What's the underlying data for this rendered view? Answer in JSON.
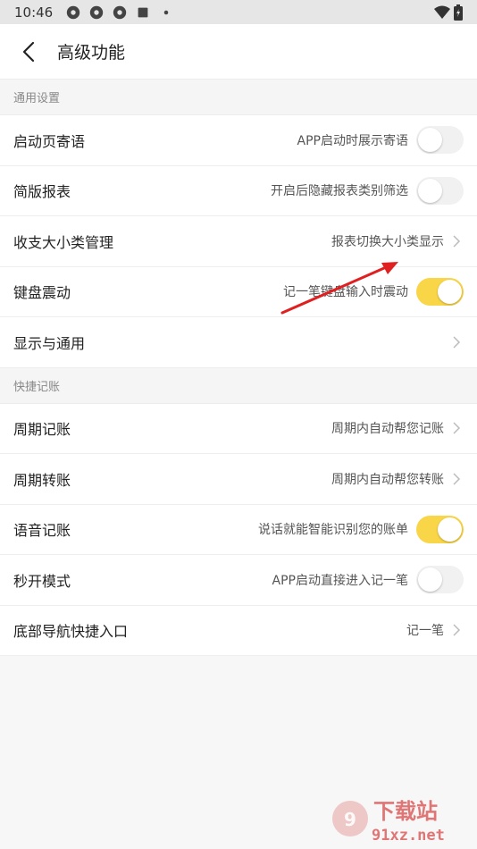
{
  "status_bar": {
    "time": "10:46"
  },
  "header": {
    "title": "高级功能"
  },
  "sections": [
    {
      "title": "通用设置",
      "rows": [
        {
          "label": "启动页寄语",
          "desc": "APP启动时展示寄语",
          "control": "toggle",
          "on": false
        },
        {
          "label": "简版报表",
          "desc": "开启后隐藏报表类别筛选",
          "control": "toggle",
          "on": false
        },
        {
          "label": "收支大小类管理",
          "desc": "报表切换大小类显示",
          "control": "chevron"
        },
        {
          "label": "键盘震动",
          "desc": "记一笔键盘输入时震动",
          "control": "toggle",
          "on": true
        },
        {
          "label": "显示与通用",
          "desc": "",
          "control": "chevron"
        }
      ]
    },
    {
      "title": "快捷记账",
      "rows": [
        {
          "label": "周期记账",
          "desc": "周期内自动帮您记账",
          "control": "chevron"
        },
        {
          "label": "周期转账",
          "desc": "周期内自动帮您转账",
          "control": "chevron"
        },
        {
          "label": "语音记账",
          "desc": "说话就能智能识别您的账单",
          "control": "toggle",
          "on": true
        },
        {
          "label": "秒开模式",
          "desc": "APP启动直接进入记一笔",
          "control": "toggle",
          "on": false
        },
        {
          "label": "底部导航快捷入口",
          "desc": "记一笔",
          "control": "chevron"
        }
      ]
    }
  ],
  "watermark": {
    "text": "下载站",
    "domain": "91xz.net"
  },
  "colors": {
    "toggle_on": "#f9d548",
    "toggle_off": "#f1f1f1",
    "annotation_arrow": "#e02020"
  }
}
